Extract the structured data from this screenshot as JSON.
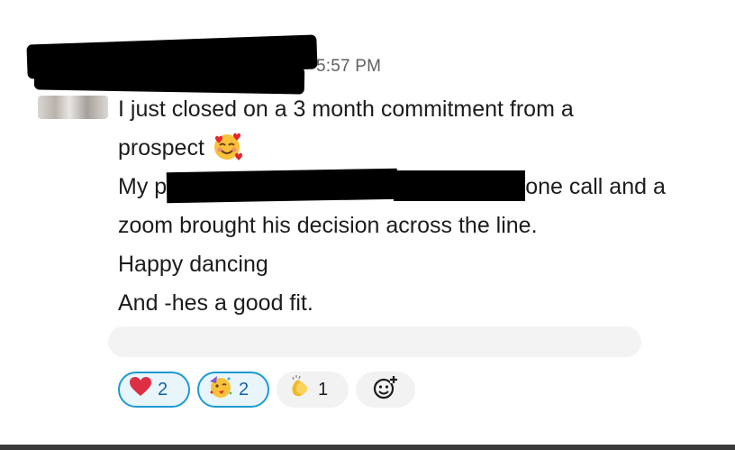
{
  "message": {
    "timestamp": "5:57 PM",
    "lines": [
      "I just closed on a 3 month commitment from a",
      "prospect",
      "My p",
      "one call and a",
      "zoom brought his decision across the line.",
      "Happy dancing",
      "And -hes a good fit."
    ],
    "inline_emoji": "smiling-face-with-hearts"
  },
  "reactions": [
    {
      "emoji": "red-heart",
      "count": "2",
      "active": true
    },
    {
      "emoji": "partying-face",
      "count": "2",
      "active": true
    },
    {
      "emoji": "clapping-hands",
      "count": "1",
      "active": false
    }
  ],
  "add_reaction_icon": "add-emoji-icon",
  "colors": {
    "active_border": "#1d9bd1",
    "active_bg": "#e8f5fa",
    "text": "#1d1c1d",
    "timestamp": "#616061"
  }
}
